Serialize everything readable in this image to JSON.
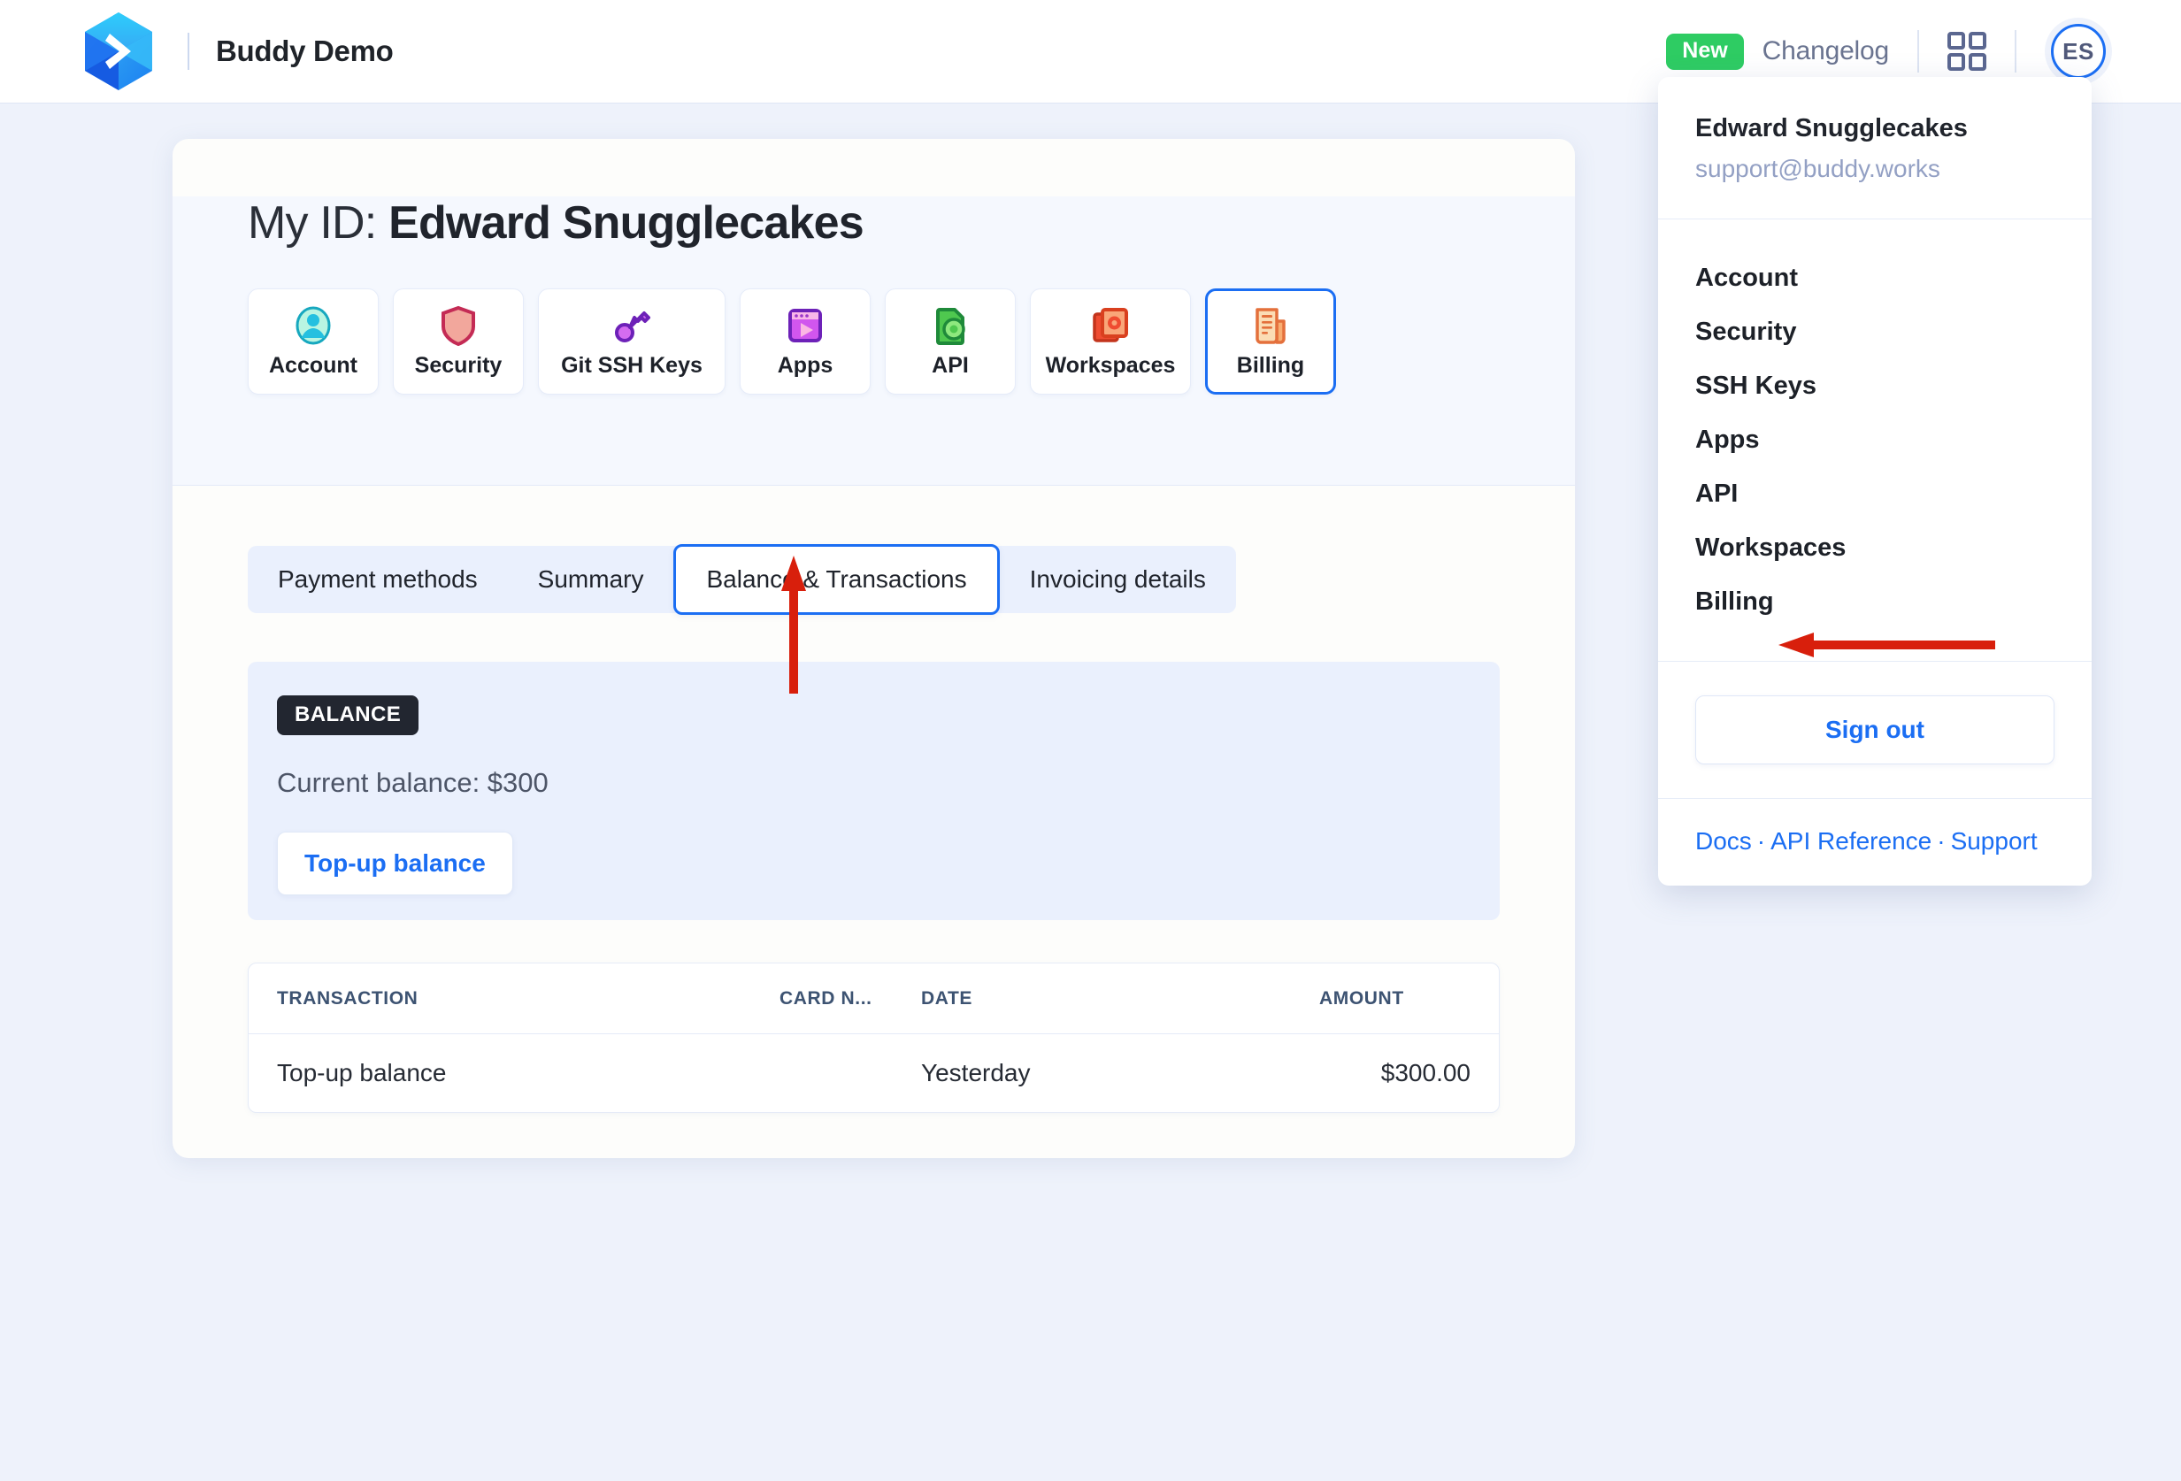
{
  "topbar": {
    "logo_icon": "buddy-hexagon-logo",
    "title": "Buddy Demo",
    "new_badge": "New",
    "changelog": "Changelog",
    "grid_icon": "app-grid-icon",
    "avatar_initials": "ES"
  },
  "main": {
    "title_prefix": "My ID:",
    "title_name": "Edward Snugglecakes",
    "icon_tabs": [
      {
        "label": "Account",
        "icon": "account-person-icon",
        "active": false
      },
      {
        "label": "Security",
        "icon": "security-shield-icon",
        "active": false
      },
      {
        "label": "Git SSH Keys",
        "icon": "ssh-key-icon",
        "active": false
      },
      {
        "label": "Apps",
        "icon": "apps-window-icon",
        "active": false
      },
      {
        "label": "API",
        "icon": "api-gear-file-icon",
        "active": false
      },
      {
        "label": "Workspaces",
        "icon": "workspaces-stack-icon",
        "active": false
      },
      {
        "label": "Billing",
        "icon": "billing-invoice-icon",
        "active": true
      }
    ],
    "sub_tabs": [
      {
        "label": "Payment methods",
        "active": false
      },
      {
        "label": "Summary",
        "active": false
      },
      {
        "label": "Balance & Transactions",
        "active": true
      },
      {
        "label": "Invoicing details",
        "active": false
      }
    ],
    "balance": {
      "badge": "BALANCE",
      "current": "Current balance: $300",
      "topup_label": "Top-up balance"
    },
    "transactions": {
      "columns": [
        "TRANSACTION",
        "CARD N...",
        "DATE",
        "AMOUNT"
      ],
      "rows": [
        {
          "transaction": "Top-up balance",
          "card": "",
          "date": "Yesterday",
          "amount": "$300.00"
        }
      ]
    }
  },
  "dropdown": {
    "user_name": "Edward Snugglecakes",
    "user_email": "support@buddy.works",
    "items": [
      {
        "label": "Account"
      },
      {
        "label": "Security"
      },
      {
        "label": "SSH Keys"
      },
      {
        "label": "Apps"
      },
      {
        "label": "API"
      },
      {
        "label": "Workspaces"
      },
      {
        "label": "Billing"
      }
    ],
    "signout": "Sign out",
    "links": [
      "Docs",
      "API Reference",
      "Support"
    ],
    "link_sep": "·"
  },
  "annotations": {
    "arrow_color": "#d81f0c",
    "arrow_to_subtab": "arrow-up-pointing-to-balance-transactions-tab",
    "arrow_to_billing": "arrow-left-pointing-to-billing-menu-item"
  },
  "colors": {
    "accent_blue": "#1b6ef3",
    "badge_green": "#2ecc63",
    "page_bg": "#eef2fb",
    "dark": "#222630"
  }
}
